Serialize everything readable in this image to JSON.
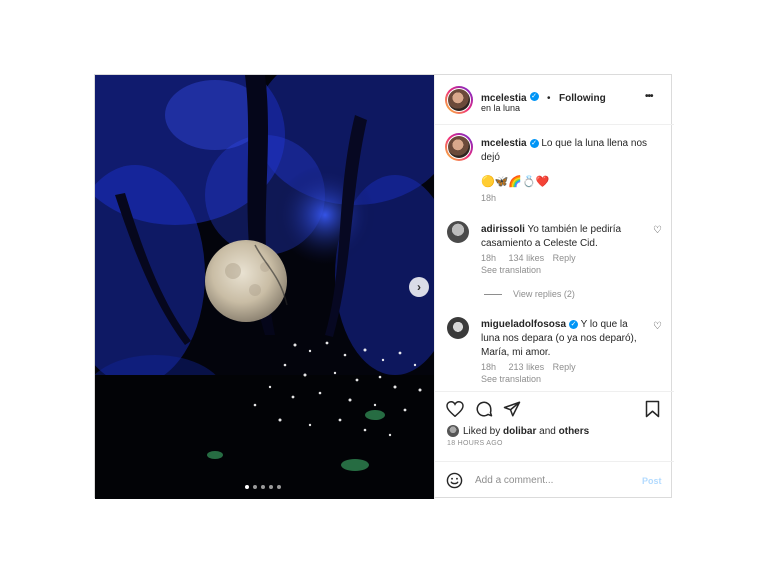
{
  "post": {
    "username": "mcelestia",
    "follow_status": "Following",
    "location": "en la luna",
    "caption": "Lo que la luna llena nos dejó",
    "caption_line1": "Lo que la luna llena nos",
    "caption_line2": "dejó",
    "emoji_line": "🟡🦋🌈💍❤️",
    "caption_time": "18h",
    "more": "•••",
    "separator": "•"
  },
  "comments": [
    {
      "username": "adirissoli",
      "text_line1": "Yo también le pediría",
      "text_line2": "casamiento a Celeste Cid.",
      "time": "18h",
      "likes": "134 likes",
      "reply": "Reply",
      "see_translation": "See translation",
      "view_replies": "View replies (2)"
    },
    {
      "username": "migueladolfososa",
      "text_line1": "Y lo que la",
      "text_line2": "luna nos depara (o ya nos deparó),",
      "text_line3": "María, mi amor.",
      "time": "18h",
      "likes": "213 likes",
      "reply": "Reply",
      "see_translation": "See translation"
    }
  ],
  "actions": {
    "liked_by_prefix": "Liked by",
    "liked_by_user": "dolibar",
    "and": "and",
    "others": "others",
    "timestamp": "18 HOURS AGO"
  },
  "comment_box": {
    "placeholder": "Add a comment...",
    "post_label": "Post"
  },
  "carousel": {
    "slides": 5,
    "active_index": 0
  },
  "colors": {
    "accent": "#0095f6",
    "post_disabled": "#b3dbff",
    "muted": "#8e8e8e"
  }
}
